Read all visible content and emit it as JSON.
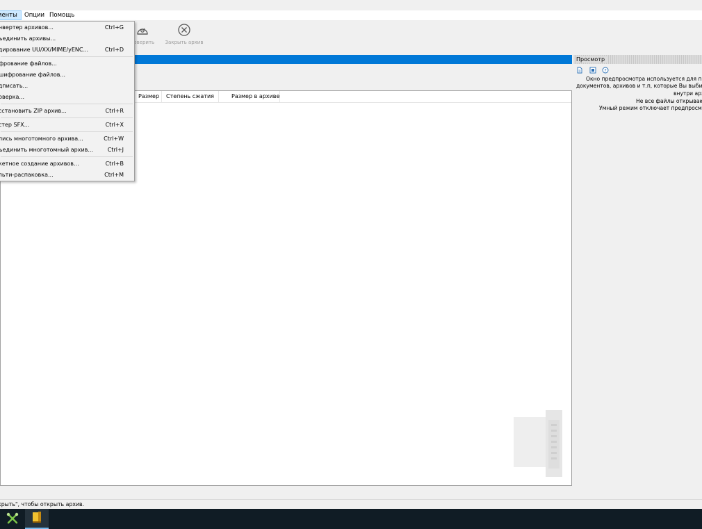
{
  "menubar": {
    "tools": "ументы",
    "options": "Опции",
    "help": "Помощь"
  },
  "toolbar": {
    "test_label": "роверить",
    "close_label": "Закрыть архив"
  },
  "dropdown": {
    "items": [
      {
        "label": "онвертер архивов...",
        "shortcut": "Ctrl+G"
      },
      {
        "label": "бъединить архивы...",
        "shortcut": ""
      },
      {
        "label": "одирование UU/XX/MIME/yENC...",
        "shortcut": "Ctrl+D"
      },
      {
        "label": "ифрование файлов...",
        "shortcut": ""
      },
      {
        "label": "ешифрование файлов...",
        "shortcut": ""
      },
      {
        "label": "одписать...",
        "shortcut": ""
      },
      {
        "label": "роверка...",
        "shortcut": ""
      },
      {
        "label": "осстановить ZIP архив...",
        "shortcut": "Ctrl+R"
      },
      {
        "label": "астер SFX...",
        "shortcut": "Ctrl+X"
      },
      {
        "label": "апись многотомного архива...",
        "shortcut": "Ctrl+W"
      },
      {
        "label": "бъединить многотомный архив...",
        "shortcut": "Ctrl+J"
      },
      {
        "label": "акетное создание архивов...",
        "shortcut": "Ctrl+B"
      },
      {
        "label": "ульти-распаковка...",
        "shortcut": "Ctrl+M"
      }
    ]
  },
  "filelist": {
    "columns": [
      "Размер",
      "Степень сжатия",
      "Размер в архиве"
    ]
  },
  "preview": {
    "title": "Просмотр",
    "lines": [
      "Окно предпросмотра используется для пр",
      "документов, архивов и т.п, которые Вы выбира",
      "внутри арх",
      "Не все файлы открываю",
      "Умный режим отключает предпросмо"
    ]
  },
  "statusbar": {
    "text": "крыть\", чтобы открыть архив."
  },
  "colors": {
    "accent": "#0078d7",
    "menu_highlight": "#cce8ff",
    "taskbar": "#101c25"
  }
}
